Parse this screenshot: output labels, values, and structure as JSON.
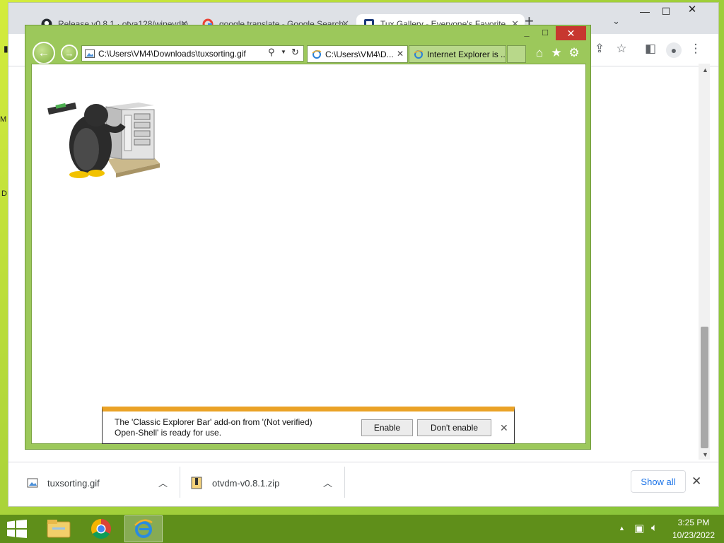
{
  "chrome": {
    "tabs": [
      {
        "title": "Release v0.8.1 · otya128/winevdm",
        "icon": "github-icon"
      },
      {
        "title": "google translate - Google Search",
        "icon": "google-icon"
      },
      {
        "title": "Tux Gallery - Everyone's Favorite",
        "icon": "site-icon"
      }
    ],
    "new_tab": "+",
    "downloads": [
      {
        "name": "tuxsorting.gif",
        "icon": "image-file-icon"
      },
      {
        "name": "otvdm-v0.8.1.zip",
        "icon": "zip-file-icon"
      }
    ],
    "show_all_label": "Show all"
  },
  "ie": {
    "address": "C:\\Users\\VM4\\Downloads\\tuxsorting.gif",
    "tabs": [
      {
        "title": "C:\\Users\\VM4\\D...",
        "icon": "ie-page-icon"
      },
      {
        "title": "Internet Explorer is ...",
        "icon": "ie-page-icon"
      }
    ],
    "notification": {
      "message": "The 'Classic Explorer Bar' add-on from '(Not verified) Open-Shell' is ready for use.",
      "enable_label": "Enable",
      "dont_enable_label": "Don't enable"
    }
  },
  "taskbar": {
    "time": "3:25 PM",
    "date": "10/23/2022",
    "apps": [
      "file-explorer-icon",
      "chrome-icon",
      "internet-explorer-icon"
    ]
  },
  "colors": {
    "ie_frame": "#9cc85b",
    "close_red": "#c7372f",
    "notification_accent": "#eaa226",
    "taskbar": "#5f8f1a",
    "chrome_link": "#1a73e8"
  }
}
